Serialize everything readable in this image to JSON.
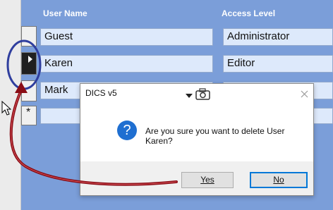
{
  "table": {
    "headers": [
      "User Name",
      "Access Level"
    ],
    "rows": [
      {
        "name": "Guest",
        "level": "Administrator"
      },
      {
        "name": "Karen",
        "level": "Editor"
      },
      {
        "name": "Mark",
        "level": ""
      },
      {
        "name": "",
        "level": ""
      }
    ],
    "new_row_marker": "*"
  },
  "dialog": {
    "title": "DICS v5",
    "message": "Are you sure you want to delete User Karen?",
    "buttons": {
      "yes": "Yes",
      "no": "No"
    },
    "question_glyph": "?"
  },
  "icons": {
    "record_selector": "current-record-triangle-icon",
    "camera": "camera-icon",
    "dropdown": "triangle-down-icon",
    "close": "close-icon",
    "question": "question-icon",
    "cursor": "mouse-pointer-icon"
  },
  "colors": {
    "sheet_blue": "#7b9ed9",
    "cell_fill": "#dde9fb",
    "annotation_red": "#a0101a",
    "annotation_blue": "#2f3e9e",
    "question_blue": "#1f6fd1"
  }
}
